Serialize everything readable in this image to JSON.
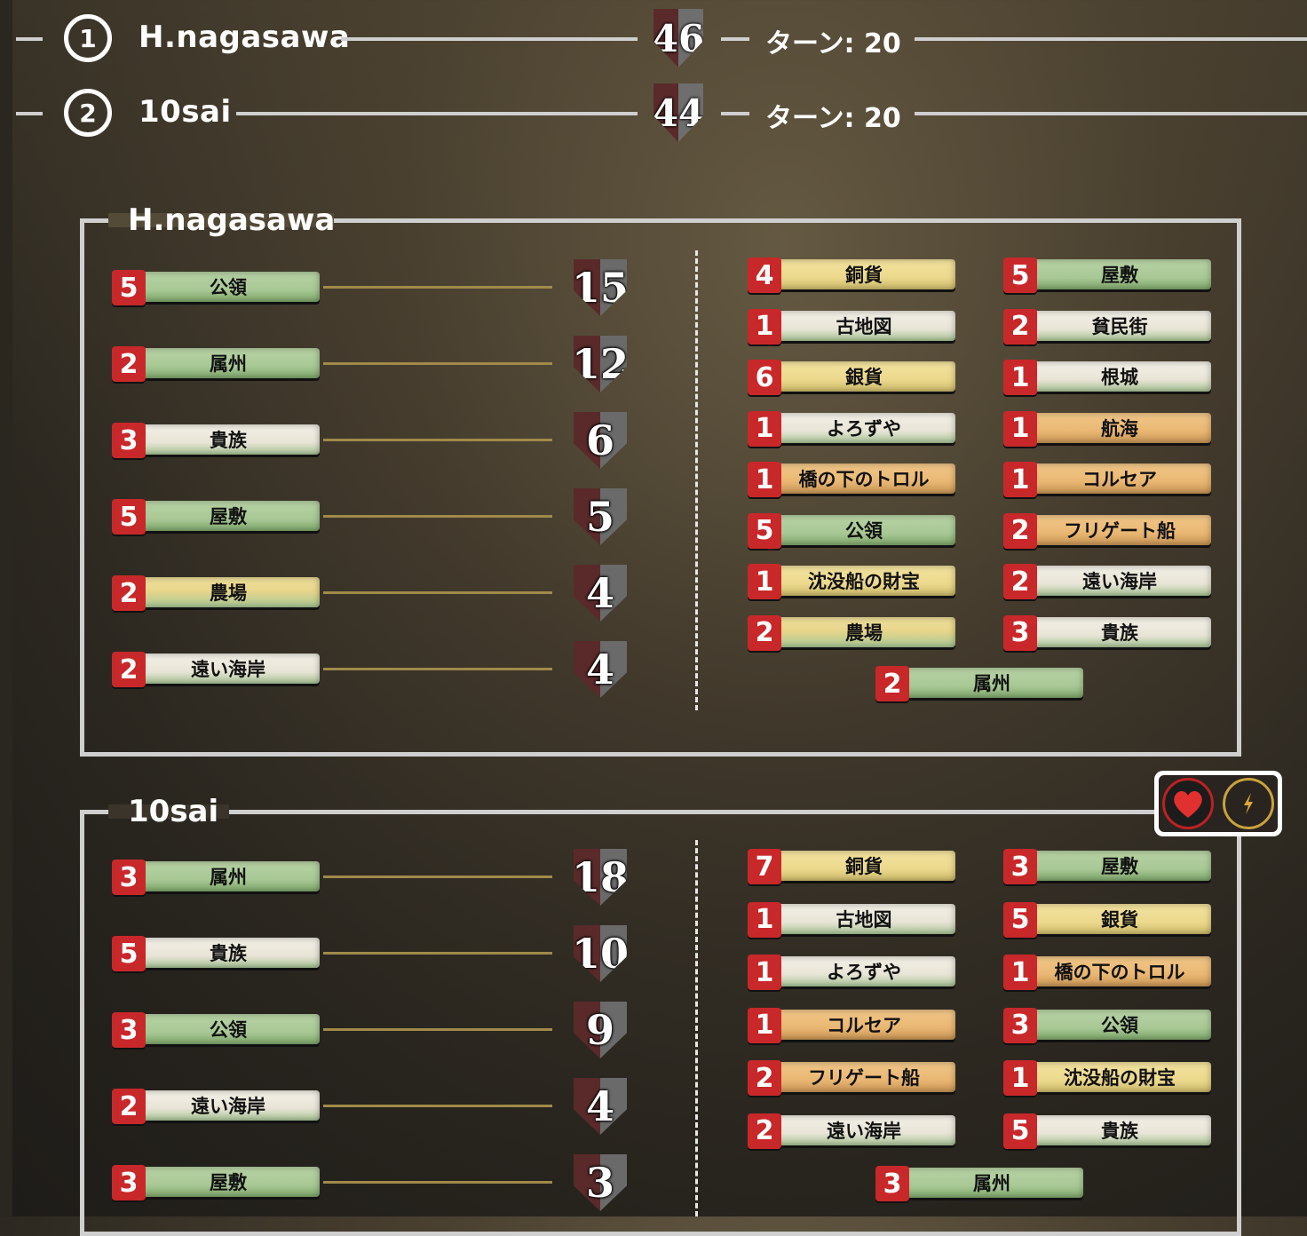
{
  "header": {
    "players": [
      {
        "rank": "1",
        "name": "H.nagasawa",
        "score": "46",
        "turn": "ターン: 20"
      },
      {
        "rank": "2",
        "name": "10sai",
        "score": "44",
        "turn": "ターン: 20"
      }
    ]
  },
  "panels": [
    {
      "title": "H.nagasawa",
      "left_rows": [
        {
          "count": "5",
          "name": "公領",
          "points": "15",
          "color": "green"
        },
        {
          "count": "2",
          "name": "属州",
          "points": "12",
          "color": "green"
        },
        {
          "count": "3",
          "name": "貴族",
          "points": "6",
          "color": "white"
        },
        {
          "count": "5",
          "name": "屋敷",
          "points": "5",
          "color": "green"
        },
        {
          "count": "2",
          "name": "農場",
          "points": "4",
          "color": "yg"
        },
        {
          "count": "2",
          "name": "遠い海岸",
          "points": "4",
          "color": "white"
        }
      ],
      "cards_col1": [
        {
          "count": "4",
          "name": "銅貨",
          "color": "yellow"
        },
        {
          "count": "1",
          "name": "古地図",
          "color": "white"
        },
        {
          "count": "6",
          "name": "銀貨",
          "color": "yellow"
        },
        {
          "count": "1",
          "name": "よろずや",
          "color": "white"
        },
        {
          "count": "1",
          "name": "橋の下のトロル",
          "color": "orange"
        },
        {
          "count": "5",
          "name": "公領",
          "color": "green"
        },
        {
          "count": "1",
          "name": "沈没船の財宝",
          "color": "yellow"
        },
        {
          "count": "2",
          "name": "農場",
          "color": "yg"
        }
      ],
      "cards_col2": [
        {
          "count": "5",
          "name": "屋敷",
          "color": "green"
        },
        {
          "count": "2",
          "name": "貧民街",
          "color": "white"
        },
        {
          "count": "1",
          "name": "根城",
          "color": "white"
        },
        {
          "count": "1",
          "name": "航海",
          "color": "orange"
        },
        {
          "count": "1",
          "name": "コルセア",
          "color": "orange"
        },
        {
          "count": "2",
          "name": "フリゲート船",
          "color": "orange"
        },
        {
          "count": "2",
          "name": "遠い海岸",
          "color": "white"
        },
        {
          "count": "3",
          "name": "貴族",
          "color": "white"
        }
      ],
      "card_center": {
        "count": "2",
        "name": "属州",
        "color": "green"
      }
    },
    {
      "title": "10sai",
      "left_rows": [
        {
          "count": "3",
          "name": "属州",
          "points": "18",
          "color": "green"
        },
        {
          "count": "5",
          "name": "貴族",
          "points": "10",
          "color": "white"
        },
        {
          "count": "3",
          "name": "公領",
          "points": "9",
          "color": "green"
        },
        {
          "count": "2",
          "name": "遠い海岸",
          "points": "4",
          "color": "white"
        },
        {
          "count": "3",
          "name": "屋敷",
          "points": "3",
          "color": "green"
        }
      ],
      "cards_col1": [
        {
          "count": "7",
          "name": "銅貨",
          "color": "yellow"
        },
        {
          "count": "1",
          "name": "古地図",
          "color": "white"
        },
        {
          "count": "1",
          "name": "よろずや",
          "color": "white"
        },
        {
          "count": "1",
          "name": "コルセア",
          "color": "orange"
        },
        {
          "count": "2",
          "name": "フリゲート船",
          "color": "orange"
        },
        {
          "count": "2",
          "name": "遠い海岸",
          "color": "white"
        }
      ],
      "cards_col2": [
        {
          "count": "3",
          "name": "屋敷",
          "color": "green"
        },
        {
          "count": "5",
          "name": "銀貨",
          "color": "yellow"
        },
        {
          "count": "1",
          "name": "橋の下のトロル",
          "color": "orange"
        },
        {
          "count": "3",
          "name": "公領",
          "color": "green"
        },
        {
          "count": "1",
          "name": "沈没船の財宝",
          "color": "yellow"
        },
        {
          "count": "5",
          "name": "貴族",
          "color": "white"
        }
      ],
      "card_center": {
        "count": "3",
        "name": "属州",
        "color": "green"
      }
    }
  ],
  "icons": [
    "heart-icon",
    "lightning-icon"
  ],
  "colors": {
    "accent_red": "#c8282a",
    "line": "#cfcfcf",
    "leader": "#a08a4a"
  }
}
